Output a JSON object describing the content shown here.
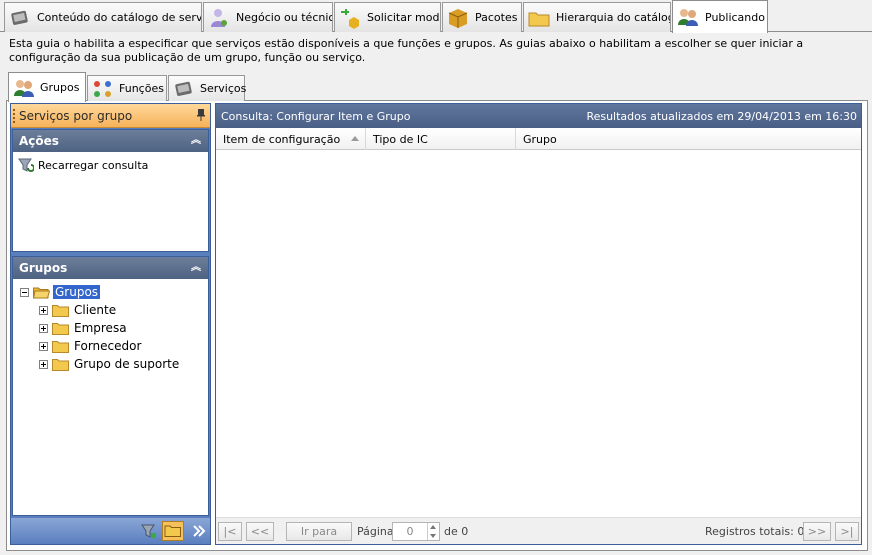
{
  "top_tabs": [
    {
      "label": "Conteúdo do catálogo de serviço",
      "icon": "catalog-book-icon"
    },
    {
      "label": "Negócio ou técnico",
      "icon": "business-user-icon"
    },
    {
      "label": "Solicitar modo",
      "icon": "request-add-icon"
    },
    {
      "label": "Pacotes",
      "icon": "package-icon"
    },
    {
      "label": "Hierarquia do catálogo",
      "icon": "folder-icon"
    },
    {
      "label": "Publicando",
      "icon": "users-icon",
      "active": true
    }
  ],
  "intro_text": "Esta guia o habilita a especificar que serviços estão disponíveis a que funções e grupos. As guias abaixo o habilitam a escolher se quer iniciar a configuração da sua publicação de um grupo, função ou serviço.",
  "inner_tabs": [
    {
      "label": "Grupos",
      "icon": "users-icon",
      "active": true
    },
    {
      "label": "Funções",
      "icon": "roles-icon"
    },
    {
      "label": "Serviços",
      "icon": "services-book-icon"
    }
  ],
  "left_pane": {
    "title": "Serviços por grupo",
    "actions_panel": {
      "header": "Ações",
      "items": [
        {
          "label": "Recarregar consulta",
          "icon": "reload-query-icon"
        }
      ]
    },
    "groups_panel": {
      "header": "Grupos",
      "root": "Grupos",
      "children": [
        "Cliente",
        "Empresa",
        "Fornecedor",
        "Grupo de suporte"
      ]
    }
  },
  "query": {
    "title": "Consulta: Configurar Item e Grupo",
    "updated": "Resultados atualizados em 29/04/2013 em 16:30",
    "columns": [
      "Item de configuração",
      "Tipo de IC",
      "Grupo"
    ],
    "sort_column": "Item de configuração",
    "rows": []
  },
  "pager": {
    "first": "|<",
    "prev": "<<",
    "go": "Ir para",
    "page_label": "Página",
    "page_value": "0",
    "of": "de 0",
    "total": "Registros totais: 0",
    "next": ">>",
    "last": ">|"
  }
}
